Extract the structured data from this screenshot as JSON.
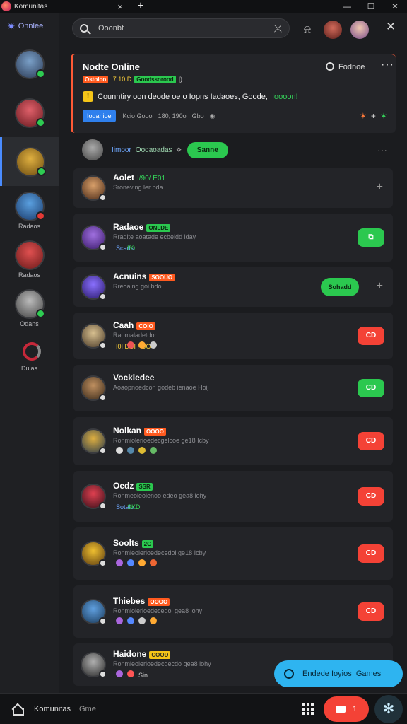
{
  "window": {
    "tab_title": "Komunitas",
    "close_glyph": "×",
    "newtab_glyph": "+",
    "minimize_glyph": "—",
    "maximize_glyph": "☐",
    "winclose_glyph": "✕"
  },
  "rail": {
    "brand": "Onnlee",
    "items": [
      {
        "label": "",
        "status": "online",
        "colors": [
          "#7aa0c8",
          "#2b3a55"
        ]
      },
      {
        "label": "",
        "status": "online",
        "colors": [
          "#e0606a",
          "#6a1a20"
        ]
      },
      {
        "label": "",
        "status": "online",
        "colors": [
          "#e0b040",
          "#6a4a10"
        ],
        "active": true
      },
      {
        "label": "Radaos",
        "status": "busy",
        "colors": [
          "#5aa0e0",
          "#1a3a6a"
        ]
      },
      {
        "label": "Radaos",
        "status": "none",
        "colors": [
          "#e05050",
          "#6a1a1a"
        ]
      },
      {
        "label": "Odans",
        "status": "online",
        "colors": [
          "#bbbbbb",
          "#444444"
        ]
      },
      {
        "label": "Dulas",
        "status": "logo"
      }
    ]
  },
  "search": {
    "value": "Ooonbt",
    "clear_glyph": "⤫"
  },
  "topbar": {
    "bell_glyph": "⍾",
    "close_glyph": "✕"
  },
  "now_card": {
    "title": "Nodte Online",
    "filter_label": "Fodnoe",
    "more": "···",
    "tag1": "Ostoloo",
    "meta": "I7.10 D",
    "tag2": "Goodssorood",
    "trail": "|)",
    "message": "Counntiry oon deode oe o Iopns Iadaoes, Goode,",
    "highlight": "Ioooon!",
    "button": "Iodarlioe",
    "m1": "Kcio Gooo",
    "m2": "180, 190o",
    "m3": "Gbo",
    "sparks": [
      "✶",
      "+",
      "✶"
    ]
  },
  "status_row": {
    "label": "Iimoor",
    "label2": "Oodaoadas",
    "pin": "⟡",
    "button": "Sanne",
    "more": "···"
  },
  "rows": [
    {
      "name": "Aolet",
      "tag": "",
      "tag_color": "",
      "name_extra": "I/90/ E01",
      "sub": "Sroneving ler bda",
      "meta": "",
      "dots": [],
      "action": "plus",
      "action_text": "",
      "colors": [
        "#d9a06a",
        "#4a2a18"
      ]
    },
    {
      "name": "Radaoe",
      "tag": "ONLDE",
      "tag_color": "green",
      "name_extra": "",
      "sub": "Rradite aoatade ecbeidd lday",
      "meta_blue": "Scads",
      "meta_green": "E0",
      "dots": [],
      "action": "green",
      "action_text": "⧉",
      "colors": [
        "#a070e0",
        "#3a1a6a"
      ]
    },
    {
      "name": "Acnuins",
      "tag": "SOOUO",
      "tag_color": "orange",
      "name_extra": "",
      "sub": "Rreoaing goi bdo",
      "meta": "",
      "dots": [],
      "action": "online+plus",
      "action_text": "Sohadd",
      "colors": [
        "#8a70ff",
        "#2a1a6a"
      ]
    },
    {
      "name": "Caah",
      "tag": "COIO",
      "tag_color": "orange",
      "name_extra": "",
      "sub": "Raomaladetdor",
      "meta_yellow": "I0I DUI FUO",
      "dots": [
        "#e55",
        "#fa3",
        "#ccc"
      ],
      "action": "red",
      "action_text": "CD",
      "colors": [
        "#d8c090",
        "#4a3a28"
      ]
    },
    {
      "name": "Vockledee",
      "tag": "",
      "tag_color": "",
      "name_extra": "",
      "sub": "Aoaopnoedcon godeb ienaoe Hoij",
      "meta": "",
      "dots": [],
      "action": "green",
      "action_text": "CD",
      "colors": [
        "#c09060",
        "#3a2a1a"
      ]
    },
    {
      "name": "Nolkan",
      "tag": "OOOO",
      "tag_color": "orange",
      "name_extra": "",
      "sub": "Ronmiolerioedecgelcoe ge18 Icby",
      "meta": "",
      "dots": [
        "#ddd",
        "#58a",
        "#db3",
        "#6b6"
      ],
      "action": "red",
      "action_text": "CD",
      "colors": [
        "#e0b040",
        "#2a3a4a"
      ]
    },
    {
      "name": "Oedz",
      "tag": "SSR",
      "tag_color": "green",
      "name_extra": "",
      "sub": "Ronmeoleolenoo edeo gea8 lohy",
      "meta_blue": "Sotalo",
      "meta_green": "SKD",
      "dots": [],
      "action": "red",
      "action_text": "CD",
      "colors": [
        "#e04050",
        "#3a101a"
      ]
    },
    {
      "name": "Soolts",
      "tag": "2G",
      "tag_color": "green",
      "name_extra": "",
      "sub": "Ronmieolerioedecedol ge18 Icby",
      "meta": "",
      "dots": [
        "#a6d",
        "#58f",
        "#fa3",
        "#e63"
      ],
      "action": "red",
      "action_text": "CD",
      "colors": [
        "#f0c030",
        "#5a3a10"
      ]
    },
    {
      "name": "Thiebes",
      "tag": "OOOO",
      "tag_color": "orange",
      "name_extra": "",
      "sub": "Ronmiolerioedecedol gea8 lohy",
      "meta": "",
      "dots": [
        "#a6d",
        "#58f",
        "#ccc",
        "#fa3"
      ],
      "action": "red",
      "action_text": "CD",
      "colors": [
        "#60a0e0",
        "#1a3a5a"
      ]
    },
    {
      "name": "Haidone",
      "tag": "COOD",
      "tag_color": "yellow",
      "name_extra": "",
      "sub": "Ronmieolerioedecgecdo gea8 lohy",
      "meta_white": "Sin",
      "dots": [
        "#a6d",
        "#f55"
      ],
      "action": "",
      "action_text": "",
      "colors": [
        "#b0b0b0",
        "#2a2a2a"
      ]
    }
  ],
  "cta": {
    "label": "Endede Ioyios",
    "label2": "Games"
  },
  "bottombar": {
    "label": "Komunitas",
    "label2": "Gme",
    "rec_count": "1",
    "flower": "✻"
  },
  "colors": {
    "accent": "#2f80ed",
    "online": "#2bc84f",
    "danger": "#f44236",
    "cta": "#2eb4f0",
    "highlight_border": "#ff5a36"
  }
}
